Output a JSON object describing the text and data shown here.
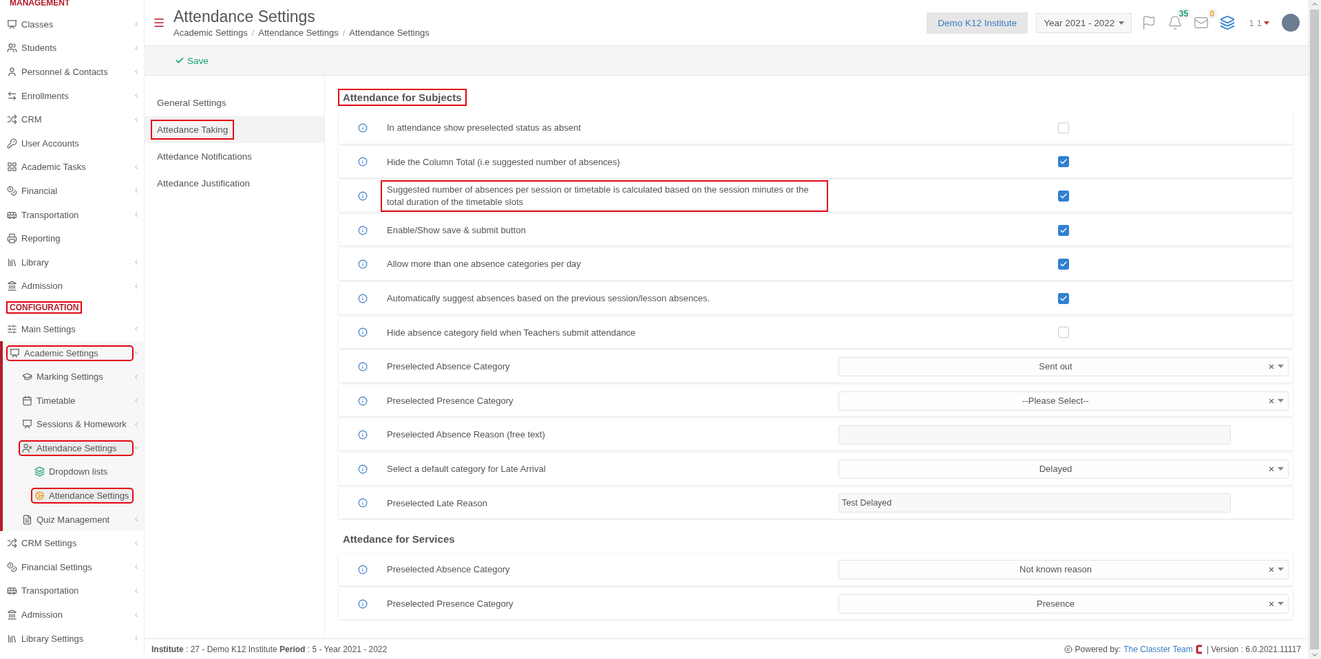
{
  "sidebar": {
    "sections": [
      {
        "title": "MANAGEMENT",
        "highlighted": false,
        "items": [
          {
            "label": "Classes",
            "kind": "group",
            "selected": false,
            "highlighted": false
          },
          {
            "label": "Students",
            "kind": "group",
            "selected": false,
            "highlighted": false
          },
          {
            "label": "Personnel & Contacts",
            "kind": "group",
            "selected": false,
            "highlighted": false
          },
          {
            "label": "Enrollments",
            "kind": "group",
            "selected": false,
            "highlighted": false
          },
          {
            "label": "CRM",
            "kind": "group",
            "selected": false,
            "highlighted": false
          },
          {
            "label": "User Accounts",
            "kind": "link",
            "selected": false,
            "highlighted": false
          },
          {
            "label": "Academic Tasks",
            "kind": "group",
            "selected": false,
            "highlighted": false
          },
          {
            "label": "Financial",
            "kind": "group",
            "selected": false,
            "highlighted": false
          },
          {
            "label": "Transportation",
            "kind": "group",
            "selected": false,
            "highlighted": false
          },
          {
            "label": "Reporting",
            "kind": "link",
            "selected": false,
            "highlighted": false
          },
          {
            "label": "Library",
            "kind": "group",
            "selected": false,
            "highlighted": false
          },
          {
            "label": "Admission",
            "kind": "group",
            "selected": false,
            "highlighted": false
          }
        ]
      },
      {
        "title": "CONFIGURATION",
        "highlighted": true,
        "items": [
          {
            "label": "Main Settings",
            "kind": "group",
            "selected": false,
            "highlighted": false
          },
          {
            "label": "Academic Settings",
            "kind": "group",
            "expanded": true,
            "selected": true,
            "highlighted": true,
            "children": [
              {
                "label": "Marking Settings",
                "kind": "group",
                "selected": false,
                "highlighted": false
              },
              {
                "label": "Timetable",
                "kind": "group",
                "selected": false,
                "highlighted": false
              },
              {
                "label": "Sessions & Homework",
                "kind": "group",
                "selected": false,
                "highlighted": false
              },
              {
                "label": "Attendance Settings",
                "kind": "group",
                "expanded": true,
                "selected": true,
                "highlighted": true,
                "children": [
                  {
                    "label": "Dropdown lists",
                    "kind": "link",
                    "selected": false,
                    "highlighted": false
                  },
                  {
                    "label": "Attendance Settings",
                    "kind": "link",
                    "selected": true,
                    "highlighted": true
                  }
                ]
              },
              {
                "label": "Quiz Management",
                "kind": "group",
                "selected": false,
                "highlighted": false
              }
            ]
          },
          {
            "label": "CRM Settings",
            "kind": "group",
            "selected": false,
            "highlighted": false
          },
          {
            "label": "Financial Settings",
            "kind": "group",
            "selected": false,
            "highlighted": false
          },
          {
            "label": "Transportation",
            "kind": "group",
            "selected": false,
            "highlighted": false
          },
          {
            "label": "Admission",
            "kind": "group",
            "selected": false,
            "highlighted": false
          },
          {
            "label": "Library Settings",
            "kind": "group",
            "selected": false,
            "highlighted": false
          }
        ]
      }
    ]
  },
  "header": {
    "title": "Attendance Settings",
    "breadcrumbs": [
      "Academic Settings",
      "Attendance Settings",
      "Attendance Settings"
    ],
    "breadcrumb_separators": [
      "/",
      "/"
    ],
    "institute": "Demo K12 Institute",
    "year": "Year 2021 - 2022",
    "notifications": [
      {
        "count": "35",
        "color": "#1aa17a"
      },
      {
        "count": "0",
        "color": "#f0a030"
      }
    ],
    "user": "1 1"
  },
  "toolbar": {
    "save": "Save"
  },
  "tabs": [
    {
      "label": "General Settings",
      "selected": false,
      "highlighted": false
    },
    {
      "label": "Attedance Taking",
      "selected": true,
      "highlighted": true
    },
    {
      "label": "Attedance Notifications",
      "selected": false,
      "highlighted": false
    },
    {
      "label": "Attedance Justification",
      "selected": false,
      "highlighted": false
    }
  ],
  "sections": [
    {
      "title": "Attendance for Subjects",
      "highlighted": true,
      "rows": [
        {
          "label": "In attendance show preselected status as absent",
          "kind": "checkbox",
          "checked": false,
          "highlighted": false
        },
        {
          "label": "Hide the Column Total (i.e suggested number of absences)",
          "kind": "checkbox",
          "checked": true,
          "highlighted": false
        },
        {
          "label": "Suggested number of absences per session or timetable is calculated based on the session minutes or the total duration of the timetable slots",
          "kind": "checkbox",
          "checked": true,
          "highlighted": true
        },
        {
          "label": "Enable/Show save & submit button",
          "kind": "checkbox",
          "checked": true,
          "highlighted": false
        },
        {
          "label": "Allow more than one absence categories per day",
          "kind": "checkbox",
          "checked": true,
          "highlighted": false
        },
        {
          "label": "Automatically suggest absences based on the previous session/lesson absences.",
          "kind": "checkbox",
          "checked": true,
          "highlighted": false
        },
        {
          "label": "Hide absence category field when Teachers submit attendance",
          "kind": "checkbox",
          "checked": false,
          "highlighted": false
        },
        {
          "label": "Preselected Absence Category",
          "kind": "select",
          "value": "Sent out",
          "highlighted": false
        },
        {
          "label": "Preselected Presence Category",
          "kind": "select",
          "value": "--Please Select--",
          "highlighted": false
        },
        {
          "label": "Preselected Absence Reason (free text)",
          "kind": "text",
          "highlighted": false
        },
        {
          "label": "Select a default category for Late Arrival",
          "kind": "select",
          "value": "Delayed",
          "highlighted": false
        },
        {
          "label": "Preselected Late Reason",
          "kind": "text",
          "value": "Test Delayed",
          "highlighted": false
        }
      ]
    },
    {
      "title": "Attedance for Services",
      "highlighted": false,
      "rows": [
        {
          "label": "Preselected Absence Category",
          "kind": "select",
          "value": "Not known reason",
          "highlighted": false
        },
        {
          "label": "Preselected Presence Category",
          "kind": "select",
          "value": "Presence",
          "highlighted": false
        }
      ]
    }
  ],
  "footer": {
    "info": "**Institute** : 27 - Demo K12 Institute **Period** : 5 - Year 2021 - 2022",
    "powered": "Powered by:",
    "link": "The Classter Team",
    "version": "| Version : 6.0.2021.11117"
  }
}
